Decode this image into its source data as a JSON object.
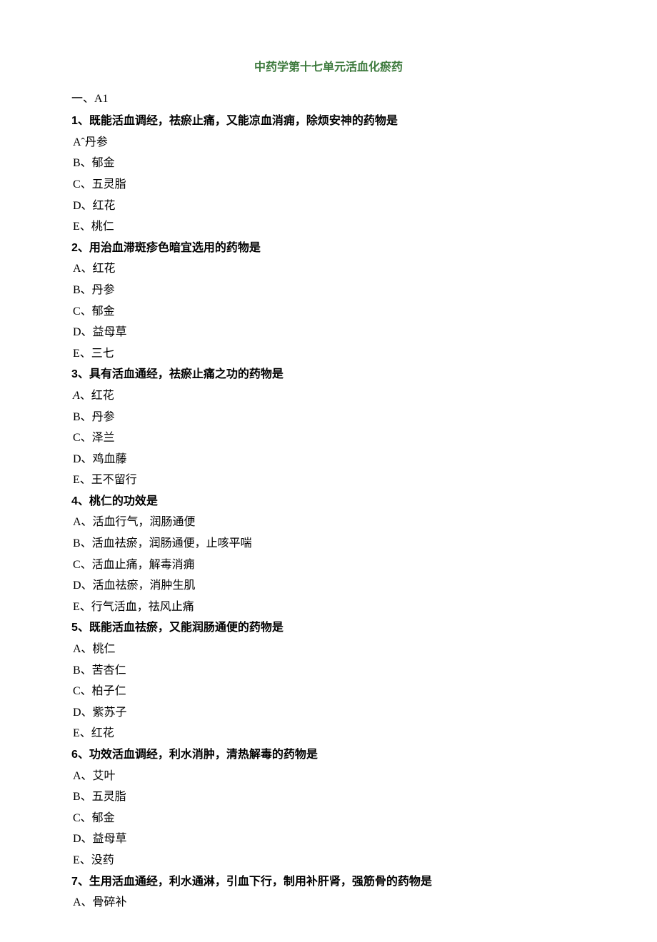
{
  "title": "中药学第十七单元活血化瘀药",
  "section_heading": "一、A1",
  "questions": [
    {
      "num": "1",
      "text": "、既能活血调经，祛瘀止痛，又能凉血消痈，除烦安神的药物是",
      "opts": [
        "Aˆ丹参",
        "B、郁金",
        "C、五灵脂",
        "D、红花",
        "E、桃仁"
      ]
    },
    {
      "num": "2",
      "text": "、用治血滞斑疹色暗宜选用的药物是",
      "opts": [
        "A、红花",
        "B、丹参",
        "C、郁金",
        "D、益母草",
        "E、三七"
      ]
    },
    {
      "num": "3",
      "text": "、具有活血通经，祛瘀止痛之功的药物是",
      "opts": [
        "A、红花",
        "B、丹参",
        "C、泽兰",
        "D、鸡血藤",
        "E、王不留行"
      ],
      "italicA": true
    },
    {
      "num": "4",
      "text": "、桃仁的功效是",
      "opts": [
        "A、活血行气，润肠通便",
        "B、活血祛瘀，润肠通便，止咳平喘",
        "C、活血止痛，解毒消痈",
        "D、活血祛瘀，消肿生肌",
        "E、行气活血，祛风止痛"
      ]
    },
    {
      "num": "5",
      "text": "、既能活血祛瘀，又能润肠通便的药物是",
      "opts": [
        "A、桃仁",
        "B、苦杏仁",
        "C、柏子仁",
        "D、紫苏子",
        "E、红花"
      ]
    },
    {
      "num": "6",
      "text": "、功效活血调经，利水消肿，清热解毒的药物是",
      "opts": [
        "A、艾叶",
        "B、五灵脂",
        "C、郁金",
        "D、益母草",
        "E、没药"
      ]
    },
    {
      "num": "7",
      "text": "、生用活血通经，利水通淋，引血下行，制用补肝肾，强筋骨的药物是",
      "opts": [
        "A、骨碎补"
      ]
    }
  ]
}
